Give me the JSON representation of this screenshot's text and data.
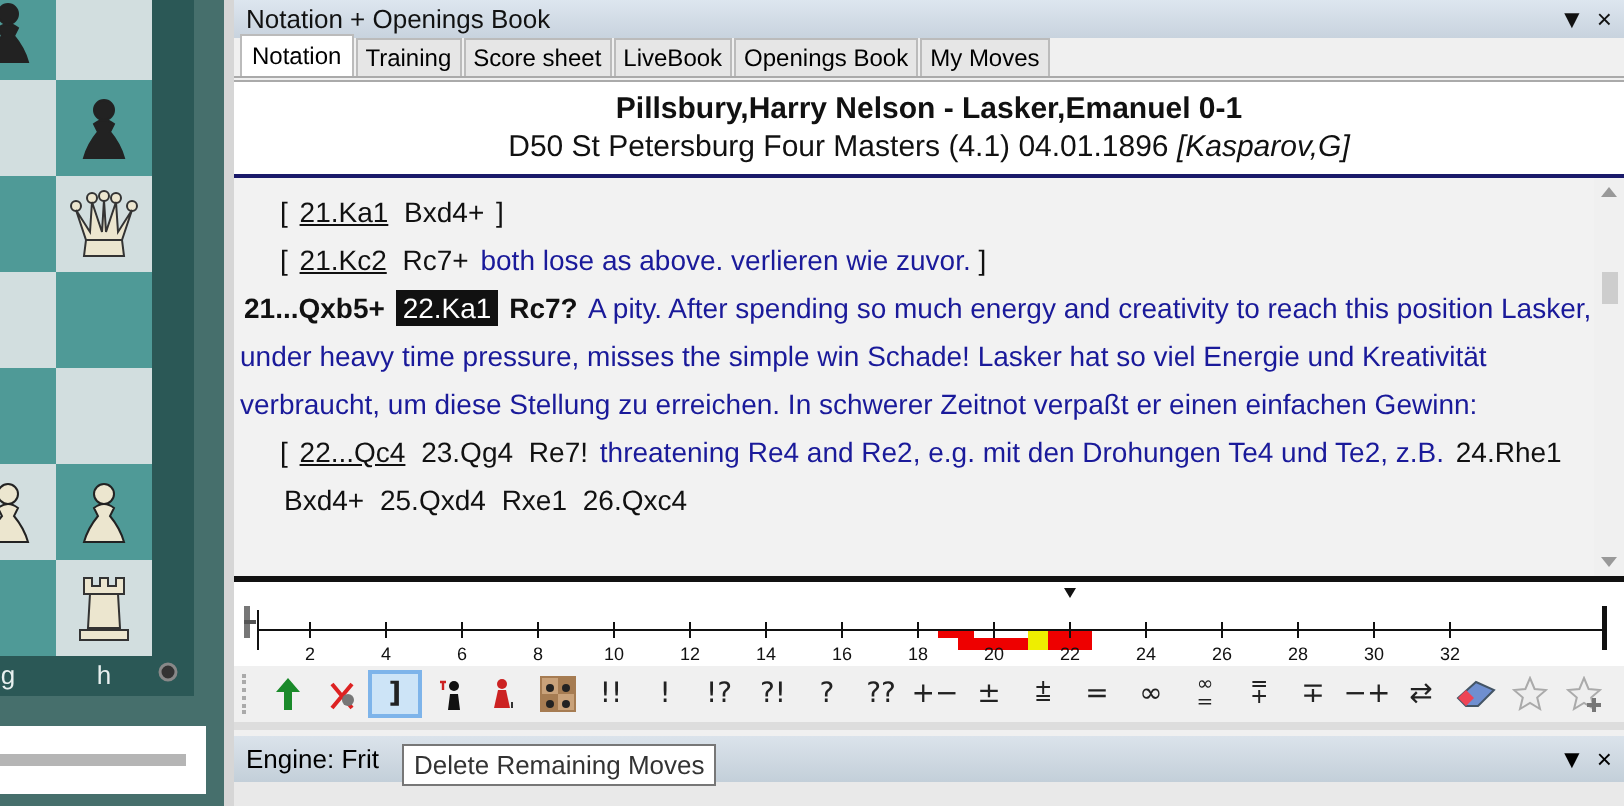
{
  "board": {
    "rows": [
      [
        {
          "kind": "black_pawn"
        },
        {
          "kind": "empty"
        }
      ],
      [
        {
          "kind": "empty"
        },
        {
          "kind": "black_pawn"
        }
      ],
      [
        {
          "kind": "empty"
        },
        {
          "kind": "white_queen"
        }
      ],
      [
        {
          "kind": "empty"
        },
        {
          "kind": "empty"
        }
      ],
      [
        {
          "kind": "empty"
        },
        {
          "kind": "empty"
        }
      ],
      [
        {
          "kind": "white_pawn"
        },
        {
          "kind": "white_pawn"
        }
      ],
      [
        {
          "kind": "empty"
        },
        {
          "kind": "white_rook"
        }
      ]
    ],
    "files": [
      "g",
      "h"
    ]
  },
  "panel": {
    "title": "Notation + Openings Book",
    "menu": "▼",
    "close": "×",
    "tabs": [
      {
        "label": "Notation",
        "selected": true
      },
      {
        "label": "Training",
        "selected": false
      },
      {
        "label": "Score sheet",
        "selected": false
      },
      {
        "label": "LiveBook",
        "selected": false
      },
      {
        "label": "Openings Book",
        "selected": false
      },
      {
        "label": "My Moves",
        "selected": false
      }
    ]
  },
  "game_header": {
    "players": "Pillsbury,Harry Nelson - Lasker,Emanuel  0-1",
    "event": "D50 St Petersburg Four Masters (4.1) 04.01.1896 *[Kasparov,G]*"
  },
  "notation": [
    {
      "kind": "variation",
      "tokens": [
        {
          "kind": "bracket",
          "text": "["
        },
        {
          "kind": "move",
          "text": "21.Ka1",
          "underlined": true,
          "selected": false
        },
        {
          "kind": "move",
          "text": "Bxd4+",
          "underlined": false,
          "selected": false
        },
        {
          "kind": "bracket",
          "text": "]"
        }
      ]
    },
    {
      "kind": "variation",
      "tokens": [
        {
          "kind": "bracket",
          "text": "["
        },
        {
          "kind": "move",
          "text": "21.Kc2",
          "underlined": true,
          "selected": false
        },
        {
          "kind": "move",
          "text": "Rc7+",
          "underlined": false,
          "selected": false
        },
        {
          "kind": "comment",
          "text": "both lose as above. verlieren wie zuvor."
        },
        {
          "kind": "bracket",
          "text": "]"
        }
      ]
    },
    {
      "kind": "main",
      "tokens": [
        {
          "kind": "move",
          "text": "21...Qxb5+",
          "underlined": false,
          "selected": false
        },
        {
          "kind": "move",
          "text": "22.Ka1",
          "underlined": false,
          "selected": true
        },
        {
          "kind": "move",
          "text": "Rc7?",
          "underlined": false,
          "selected": false
        },
        {
          "kind": "comment",
          "text": "A pity. After spending so much energy and creativity to reach this position Lasker, under heavy time pressure, misses the simple win Schade! Lasker hat so viel Energie und Kreativität verbraucht, um diese Stellung zu erreichen. In schwerer Zeitnot verpaßt er einen einfachen Gewinn:"
        }
      ]
    },
    {
      "kind": "variation",
      "tokens": [
        {
          "kind": "bracket",
          "text": "["
        },
        {
          "kind": "move",
          "text": "22...Qc4",
          "underlined": true,
          "selected": false
        },
        {
          "kind": "move",
          "text": "23.Qg4",
          "underlined": false,
          "selected": false
        },
        {
          "kind": "move",
          "text": "Re7!",
          "underlined": false,
          "selected": false
        },
        {
          "kind": "comment",
          "text": "threatening Re4 and Re2, e.g. mit den Drohungen Te4 und Te2, z.B."
        },
        {
          "kind": "move",
          "text": "24.Rhe1",
          "underlined": false,
          "selected": false
        },
        {
          "kind": "move",
          "text": "Bxd4+",
          "underlined": false,
          "selected": false
        },
        {
          "kind": "move",
          "text": "25.Qxd4",
          "underlined": false,
          "selected": false
        },
        {
          "kind": "move",
          "text": "Rxe1",
          "underlined": false,
          "selected": false
        },
        {
          "kind": "move",
          "text": "26.Qxc4",
          "underlined": false,
          "selected": false
        }
      ]
    }
  ],
  "move_axis": {
    "labels": [
      "2",
      "4",
      "6",
      "8",
      "10",
      "12",
      "14",
      "16",
      "18",
      "20",
      "22",
      "24",
      "26",
      "28",
      "30",
      "32"
    ]
  },
  "toolbar": [
    {
      "kind": "arrow",
      "selected": false
    },
    {
      "kind": "delete",
      "selected": false
    },
    {
      "kind": "text",
      "text": "]",
      "selected": true
    },
    {
      "kind": "piece",
      "selected": false
    },
    {
      "kind": "pawn",
      "selected": false
    },
    {
      "kind": "grid",
      "selected": false
    },
    {
      "kind": "text",
      "text": "!!",
      "selected": false
    },
    {
      "kind": "text",
      "text": "!",
      "selected": false
    },
    {
      "kind": "text",
      "text": "!?",
      "selected": false
    },
    {
      "kind": "text",
      "text": "?!",
      "selected": false
    },
    {
      "kind": "text",
      "text": "?",
      "selected": false
    },
    {
      "kind": "text",
      "text": "??",
      "selected": false
    },
    {
      "kind": "text",
      "text": "+−",
      "selected": false
    },
    {
      "kind": "text",
      "text": "±",
      "selected": false
    },
    {
      "kind": "text",
      "text": "⩲",
      "selected": false
    },
    {
      "kind": "text",
      "text": "=",
      "selected": false
    },
    {
      "kind": "text",
      "text": "∞",
      "selected": false
    },
    {
      "kind": "text",
      "text": "∞\n=",
      "selected": false
    },
    {
      "kind": "text",
      "text": "⩱",
      "selected": false
    },
    {
      "kind": "text",
      "text": "∓",
      "selected": false
    },
    {
      "kind": "text",
      "text": "−+",
      "selected": false
    },
    {
      "kind": "text",
      "text": "⇄",
      "selected": false
    },
    {
      "kind": "eraser",
      "selected": false
    },
    {
      "kind": "star",
      "selected": false
    },
    {
      "kind": "starplus",
      "selected": false
    }
  ],
  "tooltip": "Delete Remaining Moves",
  "engine_panel": {
    "title": "Engine: Frit",
    "menu": "▼",
    "close": "×"
  }
}
